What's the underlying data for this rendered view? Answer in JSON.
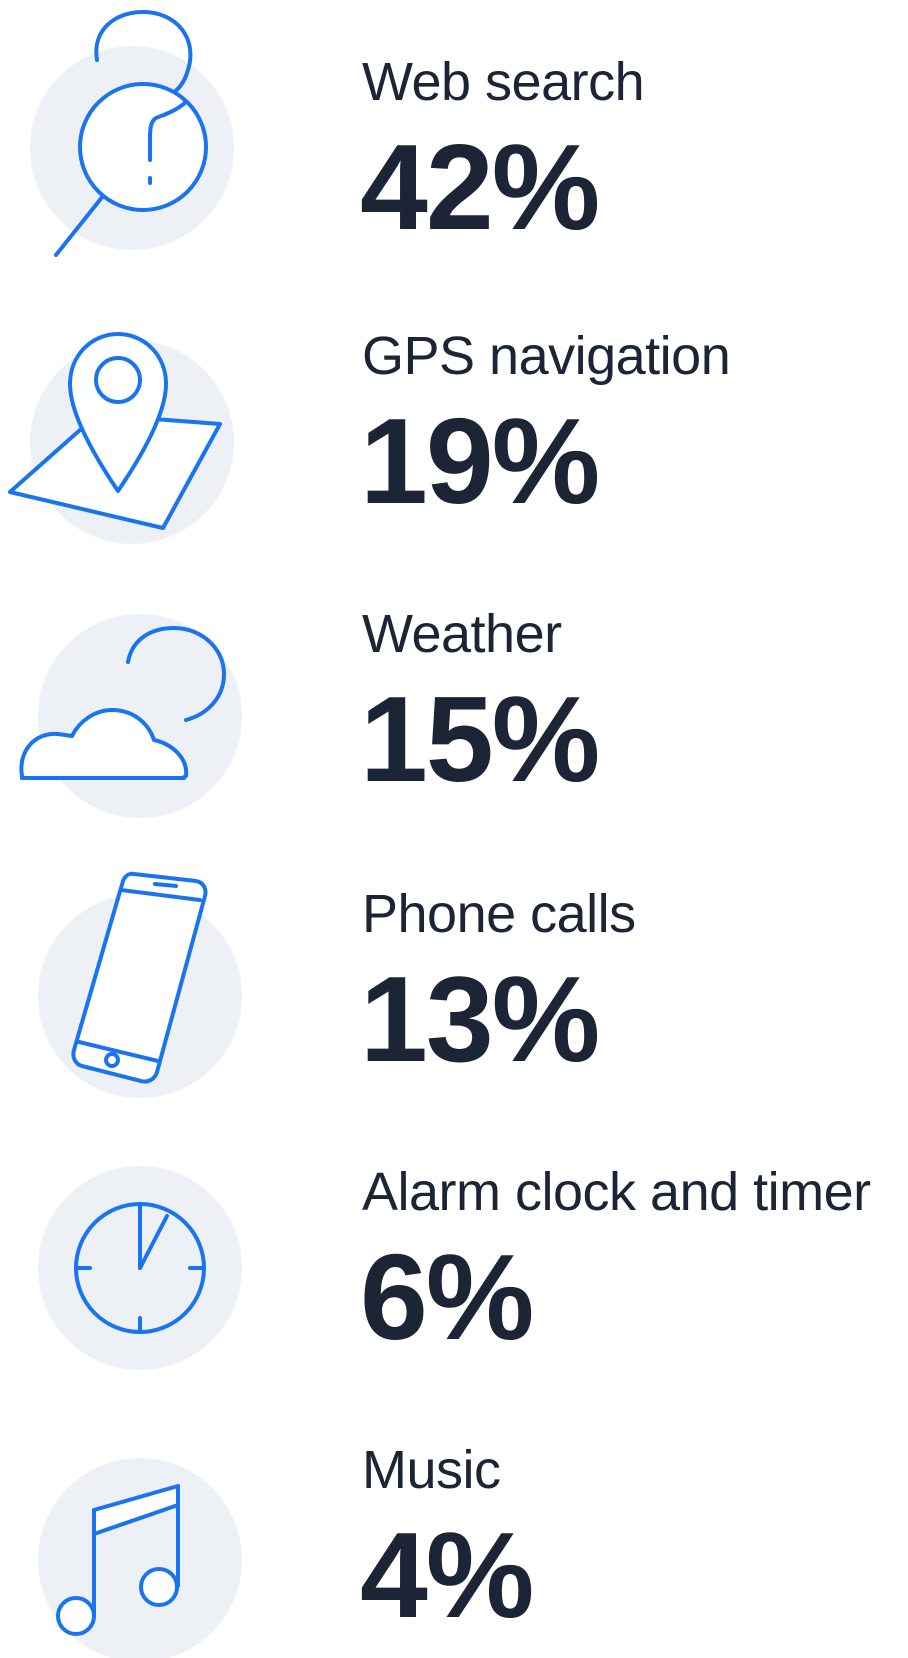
{
  "chart_data": {
    "type": "bar",
    "categories": [
      "Web search",
      "GPS navigation",
      "Weather",
      "Phone calls",
      "Alarm clock and timer",
      "Music"
    ],
    "values": [
      42,
      19,
      15,
      13,
      6,
      4
    ],
    "value_suffix": "%",
    "title": "",
    "xlabel": "",
    "ylabel": ""
  },
  "items": [
    {
      "label": "Web search",
      "value": "42%",
      "icon": "magnifier-question-icon"
    },
    {
      "label": "GPS navigation",
      "value": "19%",
      "icon": "map-pin-icon"
    },
    {
      "label": "Weather",
      "value": "15%",
      "icon": "cloud-sun-icon"
    },
    {
      "label": "Phone calls",
      "value": "13%",
      "icon": "smartphone-icon"
    },
    {
      "label": "Alarm clock and timer",
      "value": "6%",
      "icon": "clock-icon"
    },
    {
      "label": "Music",
      "value": "4%",
      "icon": "music-note-icon"
    }
  ],
  "colors": {
    "icon_stroke": "#1a73f0",
    "icon_background": "#edf0f4",
    "text": "#1c2536"
  }
}
